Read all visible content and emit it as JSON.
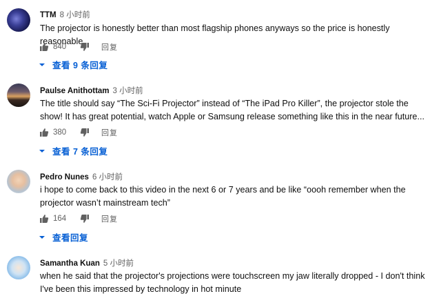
{
  "comments": [
    {
      "author": "TTM",
      "time": "8 小时前",
      "text": "The projector is honestly better than most flagship phones anyways so the price is honestly reasonable.",
      "likes": "840",
      "reply_label": "回复",
      "view_replies": "查看 9 条回复"
    },
    {
      "author": "Paulse Anithottam",
      "time": "3 小时前",
      "text": "The title should say “The Sci-Fi Projector” instead of “The iPad Pro Killer”, the projector stole the show! It has great potential, watch Apple or Samsung release something like this in the near future...",
      "likes": "380",
      "reply_label": "回复",
      "view_replies": "查看 7 条回复"
    },
    {
      "author": "Pedro Nunes",
      "time": "6 小时前",
      "text": "i hope to come back to this video in the next 6 or 7 years and be like “oooh remember when the projector wasn’t mainstream tech”",
      "likes": "164",
      "reply_label": "回复",
      "view_replies": "查看回复"
    },
    {
      "author": "Samantha Kuan",
      "time": "5 小时前",
      "text": "when he said that the projector's projections were touchscreen my jaw literally dropped - I don't think I've been this impressed by technology in hot minute"
    }
  ],
  "icons": {
    "like": "thumbs-up-icon",
    "dislike": "thumbs-down-icon",
    "expand": "caret-down-icon"
  },
  "colors": {
    "link": "#065fd4",
    "meta": "#606060",
    "text": "#0f0f0f"
  }
}
